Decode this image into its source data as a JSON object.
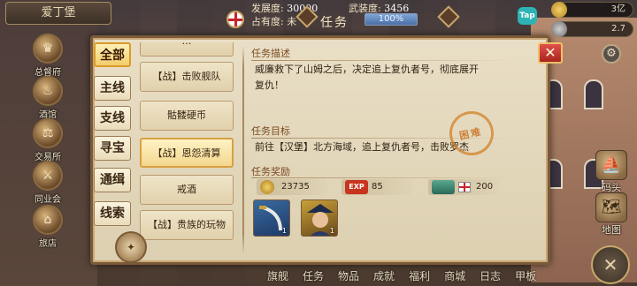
{
  "hud": {
    "city_name": "爱丁堡",
    "development_label": "发展度:",
    "development_value": "30000",
    "armament_label": "武装度:",
    "armament_value": "3456",
    "occupy_label": "占有度: 未",
    "occupy_value": "100%",
    "occupy_fraction": 1.0,
    "window_title": "任务",
    "tap_label": "Tap",
    "gold_value": "3亿",
    "gem_value": "2.7"
  },
  "city_menu": [
    {
      "label": "总督府",
      "icon": "crown-icon"
    },
    {
      "label": "酒馆",
      "icon": "tavern-icon"
    },
    {
      "label": "交易所",
      "icon": "scales-icon"
    },
    {
      "label": "同业会",
      "icon": "guild-icon"
    },
    {
      "label": "旅店",
      "icon": "inn-icon"
    }
  ],
  "category_tabs": [
    {
      "label": "全部",
      "active": true
    },
    {
      "label": "主线",
      "active": false
    },
    {
      "label": "支线",
      "active": false
    },
    {
      "label": "寻宝",
      "active": false
    },
    {
      "label": "通缉",
      "active": false
    },
    {
      "label": "线索",
      "active": false
    }
  ],
  "quest_list": [
    {
      "label": "…",
      "active": false
    },
    {
      "label": "【战】击败舰队",
      "active": false
    },
    {
      "label": "骷髅硬币",
      "active": false
    },
    {
      "label": "【战】恩怨清算",
      "active": true
    },
    {
      "label": "戒酒",
      "active": false
    },
    {
      "label": "【战】贵族的玩物",
      "active": false
    }
  ],
  "detail": {
    "desc_title": "任务描述",
    "desc_text_1": "威廉救下了山姆之后，决定追上复仇者号，彻底展开",
    "desc_text_2": "复仇！",
    "goal_title": "任务目标",
    "goal_text": "前往【汉堡】北方海域，追上复仇者号，击败罗杰",
    "reward_title": "任务奖励",
    "stamp_text": "困难",
    "rewards": [
      {
        "icon": "gold-coin-icon",
        "value": "23735"
      },
      {
        "icon": "exp-icon",
        "icon_label": "EXP",
        "value": "85"
      },
      {
        "icon": "reputation-flag-icon",
        "value": "200"
      }
    ],
    "items": [
      {
        "icon": "scimitar-icon",
        "count": "1"
      },
      {
        "icon": "captain-portrait-icon",
        "count": "1"
      }
    ]
  },
  "side_buttons": [
    {
      "label": "码头",
      "icon": "boat-icon"
    },
    {
      "label": "地图",
      "icon": "map-icon"
    }
  ],
  "bottom_nav": [
    "旗舰",
    "任务",
    "物品",
    "成就",
    "福利",
    "商城",
    "日志",
    "甲板"
  ],
  "colors": {
    "accent": "#d99a2a",
    "close_red": "#c8342e",
    "parchment": "#e9dfc6"
  }
}
